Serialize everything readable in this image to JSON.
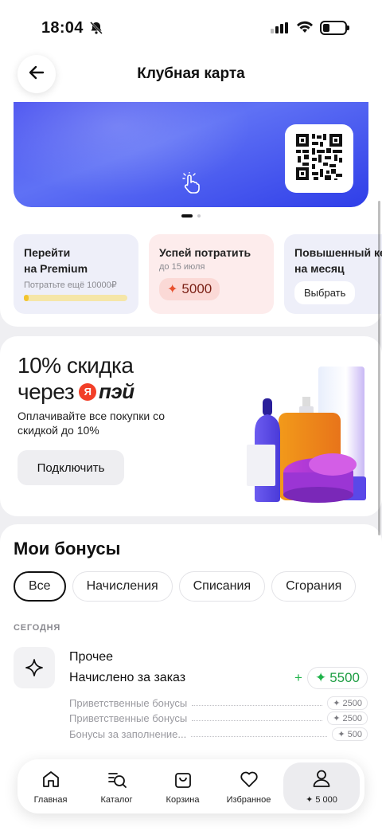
{
  "status_bar": {
    "time": "18:04"
  },
  "header": {
    "title": "Клубная карта"
  },
  "promos": [
    {
      "title_line1": "Перейти",
      "title_line2": "на Premium",
      "subtitle": "Потратьте ещё 10000₽",
      "progress": 0.03
    },
    {
      "title": "Успей потратить",
      "subtitle": "до 15 июля",
      "bonus": "5000"
    },
    {
      "title_line1": "Повышенный ке",
      "title_line2": "на месяц",
      "button": "Выбрать"
    }
  ],
  "pay_banner": {
    "title_line1": "10% скидка",
    "title_line2_prefix": "через",
    "brand_letter": "Я",
    "brand_name": "пэй",
    "description": "Оплачивайте все покупки со скидкой до 10%",
    "button": "Подключить"
  },
  "bonuses": {
    "heading": "Мои бонусы",
    "filters": [
      "Все",
      "Начисления",
      "Списания",
      "Сгорания"
    ],
    "section_label": "СЕГОДНЯ",
    "transaction": {
      "title": "Прочее",
      "description": "Начислено за заказ",
      "sign": "+",
      "amount": "5500",
      "items": [
        {
          "label": "Приветственные бонусы",
          "amount": "2500"
        },
        {
          "label": "Приветственные бонусы",
          "amount": "2500"
        },
        {
          "label": "Бонусы за заполнение...",
          "amount": "500"
        }
      ]
    }
  },
  "nav": {
    "items": [
      "Главная",
      "Каталог",
      "Корзина",
      "Избранное"
    ],
    "profile_label": "✦ 5 000"
  },
  "colors": {
    "card_blue": "#4d55f0",
    "bonus_red": "#e8502e",
    "bonus_green": "#20b34a",
    "progress_yellow": "#f2c430"
  }
}
